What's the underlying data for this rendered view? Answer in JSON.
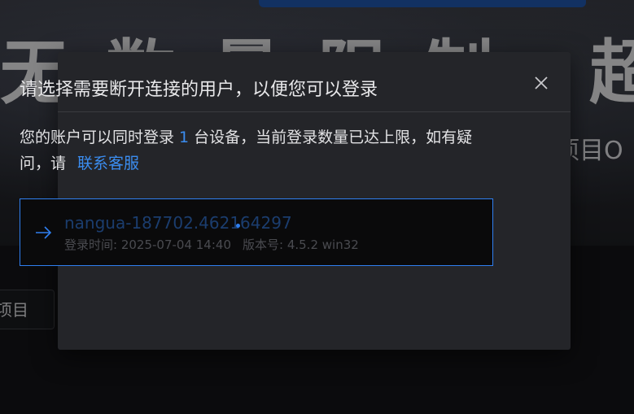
{
  "background": {
    "headline": "无数量限制 超具性",
    "subtitle": "项目O",
    "input_label": "项目"
  },
  "modal": {
    "title": "请选择需要断开连接的用户，以便您可以登录",
    "desc_before": "您的账户可以同时登录",
    "device_count": "1",
    "desc_after": "台设备，当前登录数量已达上限，如有疑问，请",
    "contact_link": "联系客服",
    "close_icon": "close-icon"
  },
  "session": {
    "name": "nangua-187702.462164297",
    "login_time_label": "登录时间: 2025-07-04 14:40",
    "version_label": "版本号: 4.5.2 win32",
    "arrow_icon": "arrow-right-icon"
  },
  "colors": {
    "accent": "#3b8df0",
    "modal_bg": "#242529",
    "card_border": "#2f7ff0"
  }
}
